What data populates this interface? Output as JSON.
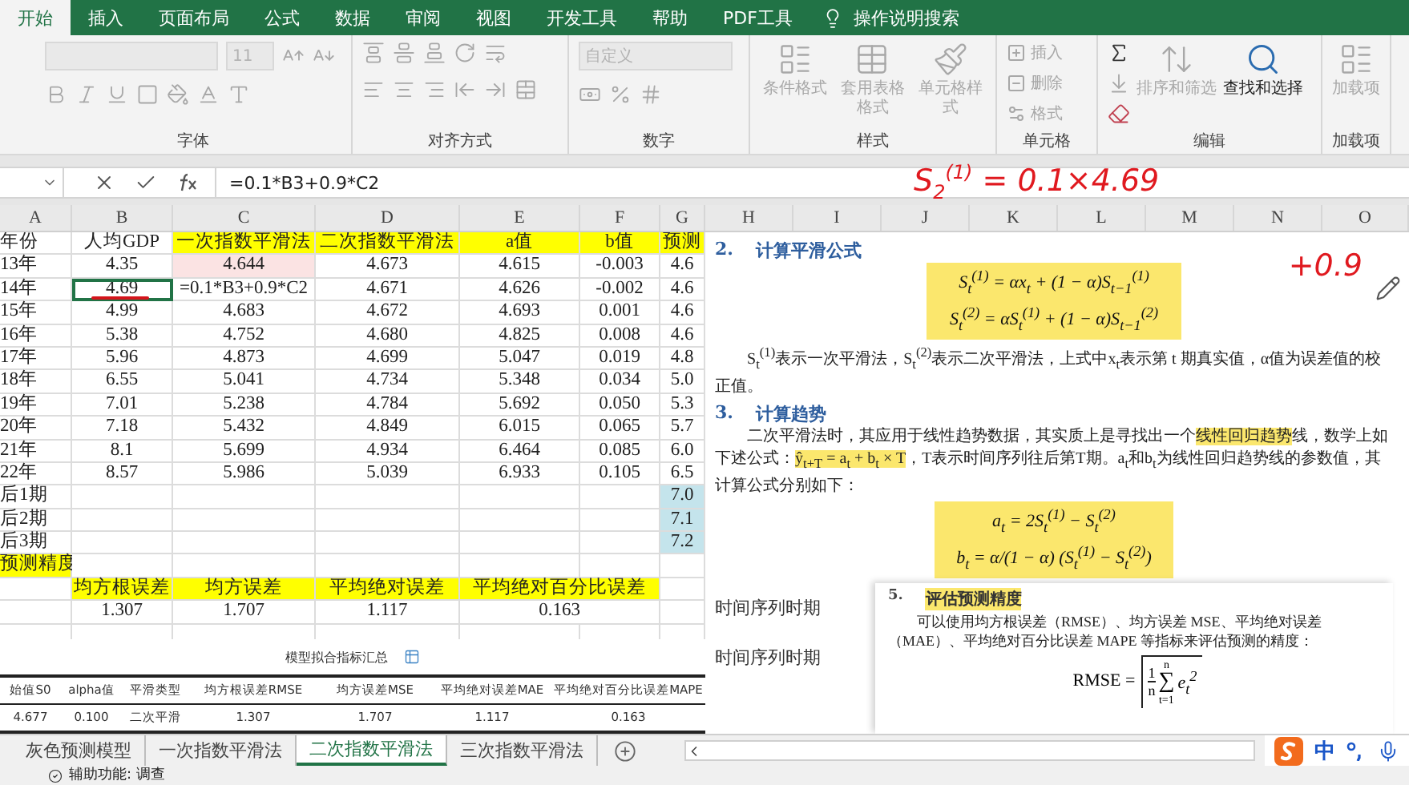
{
  "tabs": [
    {
      "label": "开始",
      "selected": true
    },
    {
      "label": "插入",
      "selected": false
    },
    {
      "label": "页面布局",
      "selected": false
    },
    {
      "label": "公式",
      "selected": false
    },
    {
      "label": "数据",
      "selected": false
    },
    {
      "label": "审阅",
      "selected": false
    },
    {
      "label": "视图",
      "selected": false
    },
    {
      "label": "开发工具",
      "selected": false
    },
    {
      "label": "帮助",
      "selected": false
    },
    {
      "label": "PDF工具",
      "selected": false
    }
  ],
  "tell_me": {
    "placeholder": "操作说明搜索"
  },
  "ribbon": {
    "groups": [
      {
        "kind": "font",
        "label": "字体",
        "font_size": "11"
      },
      {
        "kind": "alignment",
        "label": "对齐方式"
      },
      {
        "kind": "number",
        "label": "数字",
        "format": "自定义"
      },
      {
        "kind": "large",
        "label": "样式",
        "buttons": [
          {
            "label": "条件格式",
            "disabled": true
          },
          {
            "label": "套用表格格式",
            "disabled": true
          },
          {
            "label": "单元格样式",
            "disabled": true
          }
        ]
      },
      {
        "kind": "list",
        "label": "单元格",
        "buttons": [
          {
            "label": "插入",
            "disabled": true
          },
          {
            "label": "删除",
            "disabled": true
          },
          {
            "label": "格式",
            "disabled": true
          }
        ]
      },
      {
        "kind": "editing",
        "label": "编辑",
        "buttons": [
          {
            "label": "排序和筛选",
            "disabled": true
          },
          {
            "label": "查找和选择",
            "disabled": false
          }
        ]
      },
      {
        "kind": "large",
        "label": "加载项",
        "buttons": [
          {
            "label": "加载项",
            "disabled": true
          }
        ]
      }
    ]
  },
  "formula_bar": {
    "value": "=0.1*B3+0.9*C2"
  },
  "sheet": {
    "columns": [
      "A",
      "B",
      "C",
      "D",
      "E",
      "F",
      "G",
      "H",
      "I",
      "J",
      "K",
      "L",
      "M",
      "N",
      "O"
    ],
    "rows": [
      {
        "cells": [
          "年份",
          "人均GDP",
          {
            "text": "一次指数平滑法",
            "color": "#ffff00"
          },
          {
            "text": "二次指数平滑法",
            "color": "#ffff00"
          },
          {
            "text": "a值",
            "color": "#ffff00"
          },
          {
            "text": "b值",
            "color": "#ffff00"
          },
          {
            "text": "预测",
            "color": "#ffff00"
          }
        ]
      },
      {
        "cells": [
          "13年",
          "4.35",
          {
            "text": "4.644",
            "color": "#fbe3e3"
          },
          "4.673",
          "4.615",
          "-0.003",
          "4.6"
        ]
      },
      {
        "cells": [
          "14年",
          {
            "text": "4.69",
            "selected": true,
            "ink_underline": true
          },
          "=0.1*B3+0.9*C2",
          "4.671",
          "4.626",
          "-0.002",
          "4.6"
        ]
      },
      {
        "cells": [
          "15年",
          "4.99",
          "4.683",
          "4.672",
          "4.693",
          "0.001",
          "4.6"
        ]
      },
      {
        "cells": [
          "16年",
          "5.38",
          "4.752",
          "4.680",
          "4.825",
          "0.008",
          "4.6"
        ]
      },
      {
        "cells": [
          "17年",
          "5.96",
          "4.873",
          "4.699",
          "5.047",
          "0.019",
          "4.8"
        ]
      },
      {
        "cells": [
          "18年",
          "6.55",
          "5.041",
          "4.734",
          "5.348",
          "0.034",
          "5.0"
        ]
      },
      {
        "cells": [
          "19年",
          "7.01",
          "5.238",
          "4.784",
          "5.692",
          "0.050",
          "5.3"
        ]
      },
      {
        "cells": [
          "20年",
          "7.18",
          "5.432",
          "4.849",
          "6.015",
          "0.065",
          "5.7"
        ]
      },
      {
        "cells": [
          "21年",
          "8.1",
          "5.699",
          "4.934",
          "6.464",
          "0.085",
          "6.0"
        ]
      },
      {
        "cells": [
          "22年",
          "8.57",
          "5.986",
          "5.039",
          "6.933",
          "0.105",
          "6.5"
        ]
      },
      {
        "cells": [
          "后1期",
          null,
          null,
          null,
          null,
          null,
          {
            "text": "7.0",
            "color": "#c4e4ec"
          }
        ]
      },
      {
        "cells": [
          "后2期",
          null,
          null,
          null,
          null,
          null,
          {
            "text": "7.1",
            "color": "#c4e4ec"
          }
        ]
      },
      {
        "cells": [
          "后3期",
          null,
          null,
          null,
          null,
          null,
          {
            "text": "7.2",
            "color": "#c4e4ec"
          }
        ]
      },
      {
        "cells": [
          {
            "text": "预测精度",
            "color": "#ffff00"
          },
          null,
          null,
          null,
          null,
          null,
          null
        ]
      },
      {
        "cells": [
          null,
          {
            "text": "均方根误差",
            "color": "#ffff00"
          },
          {
            "text": "均方误差",
            "color": "#ffff00"
          },
          {
            "text": "平均绝对误差",
            "color": "#ffff00"
          },
          {
            "text": "平均绝对百分比误差",
            "color": "#ffff00",
            "kind": "merged"
          },
          null
        ]
      },
      {
        "cells": [
          null,
          "1.307",
          "1.707",
          "1.117",
          {
            "text": "0.163",
            "kind": "merged"
          },
          null
        ]
      },
      {
        "cells": [
          null,
          null,
          null,
          null,
          null,
          null,
          null
        ]
      }
    ]
  },
  "summary": {
    "title": "模型拟合指标汇总",
    "columns": [
      "始值S0",
      "alpha值",
      "平滑类型",
      "均方根误差RMSE",
      "均方误差MSE",
      "平均绝对误差MAE",
      "平均绝对百分比误差MAPE"
    ],
    "rows": [
      [
        "4.677",
        "0.100",
        "二次平滑",
        "1.307",
        "1.707",
        "1.117",
        "0.163"
      ]
    ]
  },
  "document": {
    "blocks": [
      {
        "kind": "heading",
        "number": "2.",
        "text": "计算平滑公式"
      },
      {
        "kind": "formula",
        "lines": [
          "S$_{t}$$^{(1)}$ = αx$_{t}$ + (1 − α)S$_{t−1}$$^{(1)}$",
          "S$_{t}$$^{(2)}$ = αS$_{t}$$^{(1)}$ + (1 − α)S$_{t−1}$$^{(2)}$"
        ]
      },
      {
        "kind": "paragraph",
        "segments": [
          {
            "text": "S$_{t}$$^{(1)}$表示一次平滑法，S$_{t}$$^{(2)}$表示二次平滑法，上式中x$_{t}$表示第 t 期真实值，α值为误差值的校正值。",
            "highlighted": false
          }
        ]
      },
      {
        "kind": "heading",
        "number": "3.",
        "text": "计算趋势"
      },
      {
        "kind": "paragraph",
        "segments": [
          {
            "text": "二次平滑法时，其应用于线性趋势数据，其实质上是寻找出一个",
            "highlighted": false
          },
          {
            "text": "线性回归趋势",
            "highlighted": true
          },
          {
            "text": "线，数学上如下述公式：",
            "highlighted": false
          },
          {
            "text": "ŷ$_{t+T}$ = a$_{t}$ + b$_{t}$ × T",
            "highlighted": true
          },
          {
            "text": "，T表示时间序列往后第T期。a$_{t}$和b$_{t}$为线性回归趋势线的参数值，其计算公式分别如下：",
            "highlighted": false
          }
        ]
      },
      {
        "kind": "formula",
        "lines": [
          "a$_{t}$ = 2S$_{t}$$^{(1)}$ − S$_{t}$$^{(2)}$",
          "b$_{t}$ = α/(1 − α) (S$_{t}$$^{(1)}$ − S$_{t}$$^{(2)}$)"
        ]
      }
    ]
  },
  "second_document": {
    "side_texts": [
      "时间序列时期",
      "时间序列时期"
    ],
    "heading": {
      "number": "5.",
      "text": "评估预测精度"
    },
    "paragraph": "可以使用均方根误差（RMSE）、均方误差 MSE、平均绝对误差（MAE）、平均绝对百分比误差 MAPE 等指标来评估预测的精度：",
    "formula": {
      "lhs": "RMSE =",
      "numerator": "1",
      "denominator": "n",
      "sum_sign": "∑",
      "sum_top": "n",
      "sum_bottom": "t=1",
      "term": "e$_{t}$$^{2}$"
    }
  },
  "annotation": {
    "lines": [
      "S$_{2}$$^{(1)}$ = 0.1×4.69",
      "+0.9"
    ]
  },
  "sheet_tabs": [
    {
      "label": "灰色预测模型",
      "selected": false
    },
    {
      "label": "一次指数平滑法",
      "selected": false
    },
    {
      "label": "二次指数平滑法",
      "selected": true
    },
    {
      "label": "三次指数平滑法",
      "selected": false
    }
  ],
  "ime": {
    "mode": "中"
  },
  "status_bar": {
    "text": "辅助功能: 调查"
  }
}
